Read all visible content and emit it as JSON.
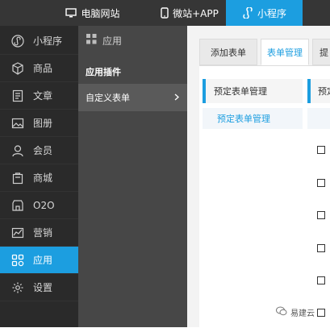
{
  "topbar": {
    "tabs": [
      {
        "label": "电脑网站",
        "icon": "monitor-icon",
        "active": false
      },
      {
        "label": "微站+APP",
        "icon": "phone-icon",
        "active": false
      },
      {
        "label": "小程序",
        "icon": "miniprogram-icon",
        "active": true
      }
    ]
  },
  "leftnav": {
    "items": [
      {
        "label": "小程序",
        "icon": "miniprogram-icon"
      },
      {
        "label": "商品",
        "icon": "box-icon"
      },
      {
        "label": "文章",
        "icon": "document-icon"
      },
      {
        "label": "图册",
        "icon": "image-icon"
      },
      {
        "label": "会员",
        "icon": "user-icon"
      },
      {
        "label": "商城",
        "icon": "shop-icon"
      },
      {
        "label": "O2O",
        "icon": "store-icon"
      },
      {
        "label": "营销",
        "icon": "chart-icon"
      },
      {
        "label": "应用",
        "icon": "apps-grid-icon",
        "active": true
      },
      {
        "label": "设置",
        "icon": "gear-icon"
      }
    ]
  },
  "subpanel": {
    "header": "应用",
    "section_title": "应用插件",
    "item": "自定义表单"
  },
  "main": {
    "tabs": [
      {
        "label": "添加表单"
      },
      {
        "label": "表单管理",
        "active": true
      },
      {
        "label": "提"
      }
    ],
    "panel_title": "预定表单管理",
    "panel_link": "预定表单管理",
    "panel_right_title": "预定"
  },
  "watermark": "易建云",
  "colors": {
    "accent": "#1c9ee0",
    "topbar": "#363636",
    "nav": "#2a2a2a",
    "subpanel": "#474747"
  }
}
